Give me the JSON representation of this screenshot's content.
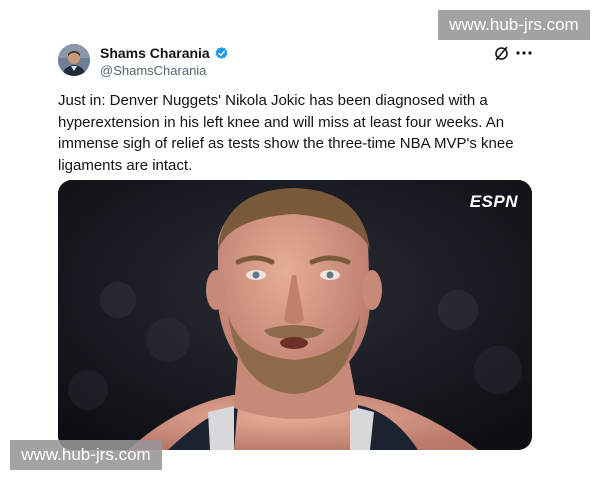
{
  "watermark": {
    "top_text": "www.hub-jrs.com",
    "bottom_text": "www.hub-jrs.com"
  },
  "author": {
    "name": "Shams Charania",
    "handle": "@ShamsCharania",
    "verified": true
  },
  "tweet": {
    "text": "Just in: Denver Nuggets' Nikola Jokic has been diagnosed with a hyperextension in his left knee and will miss at least four weeks. An immense sigh of relief as tests show the three-time NBA MVP's knee ligaments are intact."
  },
  "media": {
    "network_logo": "ESPN"
  },
  "icons": {
    "verified": "verified-badge-icon",
    "grok": "grok-icon",
    "more": "more-options-icon"
  },
  "colors": {
    "verified_blue": "#1d9bf0",
    "handle_gray": "#536471",
    "text": "#0f1419"
  }
}
